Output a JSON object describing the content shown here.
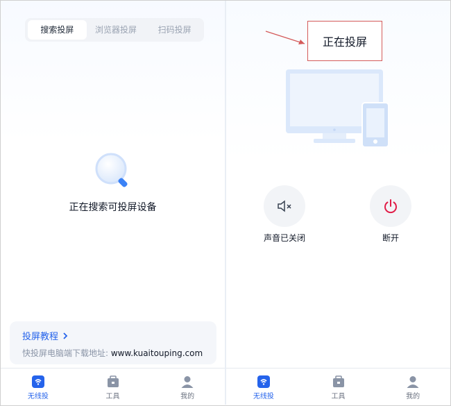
{
  "left_panel": {
    "tabs": [
      {
        "label": "搜索投屏",
        "active": true
      },
      {
        "label": "浏览器投屏",
        "active": false
      },
      {
        "label": "扫码投屏",
        "active": false
      }
    ],
    "status_text": "正在搜索可投屏设备",
    "tutorial": {
      "title": "投屏教程",
      "download_prefix": "快投屏电脑端下载地址: ",
      "download_url": "www.kuaitouping.com"
    },
    "nav": [
      {
        "label": "无线投",
        "icon": "wireless-cast-icon",
        "active": true
      },
      {
        "label": "工具",
        "icon": "toolbox-icon",
        "active": false
      },
      {
        "label": "我的",
        "icon": "profile-icon",
        "active": false
      }
    ]
  },
  "right_panel": {
    "status_label": "正在投屏",
    "controls": {
      "mute_label": "声音已关闭",
      "disconnect_label": "断开"
    },
    "nav": [
      {
        "label": "无线投",
        "icon": "wireless-cast-icon",
        "active": true
      },
      {
        "label": "工具",
        "icon": "toolbox-icon",
        "active": false
      },
      {
        "label": "我的",
        "icon": "profile-icon",
        "active": false
      }
    ]
  },
  "colors": {
    "accent": "#2563eb",
    "annotation": "#d45a5a"
  }
}
